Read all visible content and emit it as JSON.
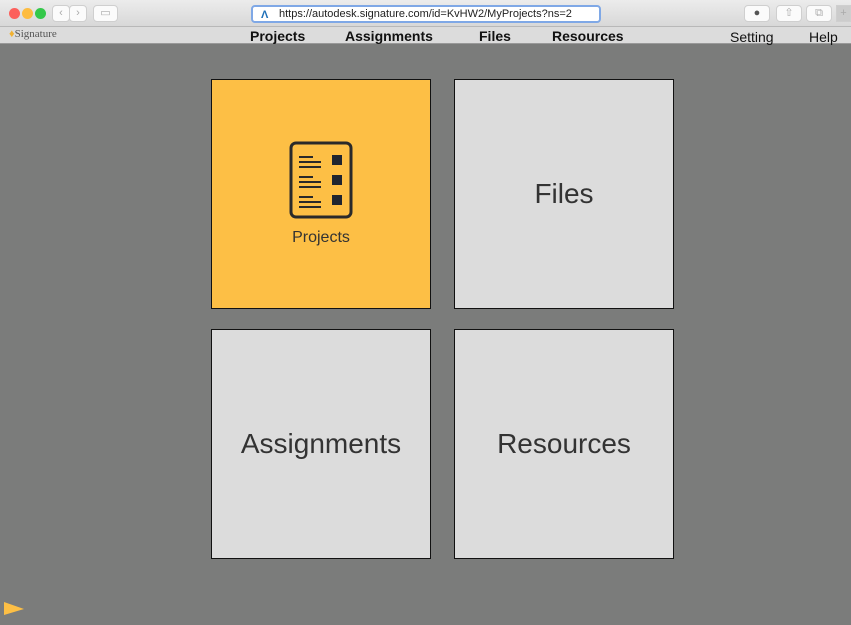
{
  "browser": {
    "url": "https://autodesk.signature.com/id=KvHW2/MyProjects?ns=2"
  },
  "brand": "Signature",
  "nav": {
    "items": [
      "Projects",
      "Assignments",
      "Files",
      "Resources"
    ],
    "setting": "Setting",
    "help": "Help"
  },
  "tiles": {
    "projects": "Projects",
    "files": "Files",
    "assignments": "Assignments",
    "resources": "Resources"
  },
  "colors": {
    "accent": "#fdbf45",
    "tile": "#dcdcdc",
    "background": "#7b7c7b"
  }
}
